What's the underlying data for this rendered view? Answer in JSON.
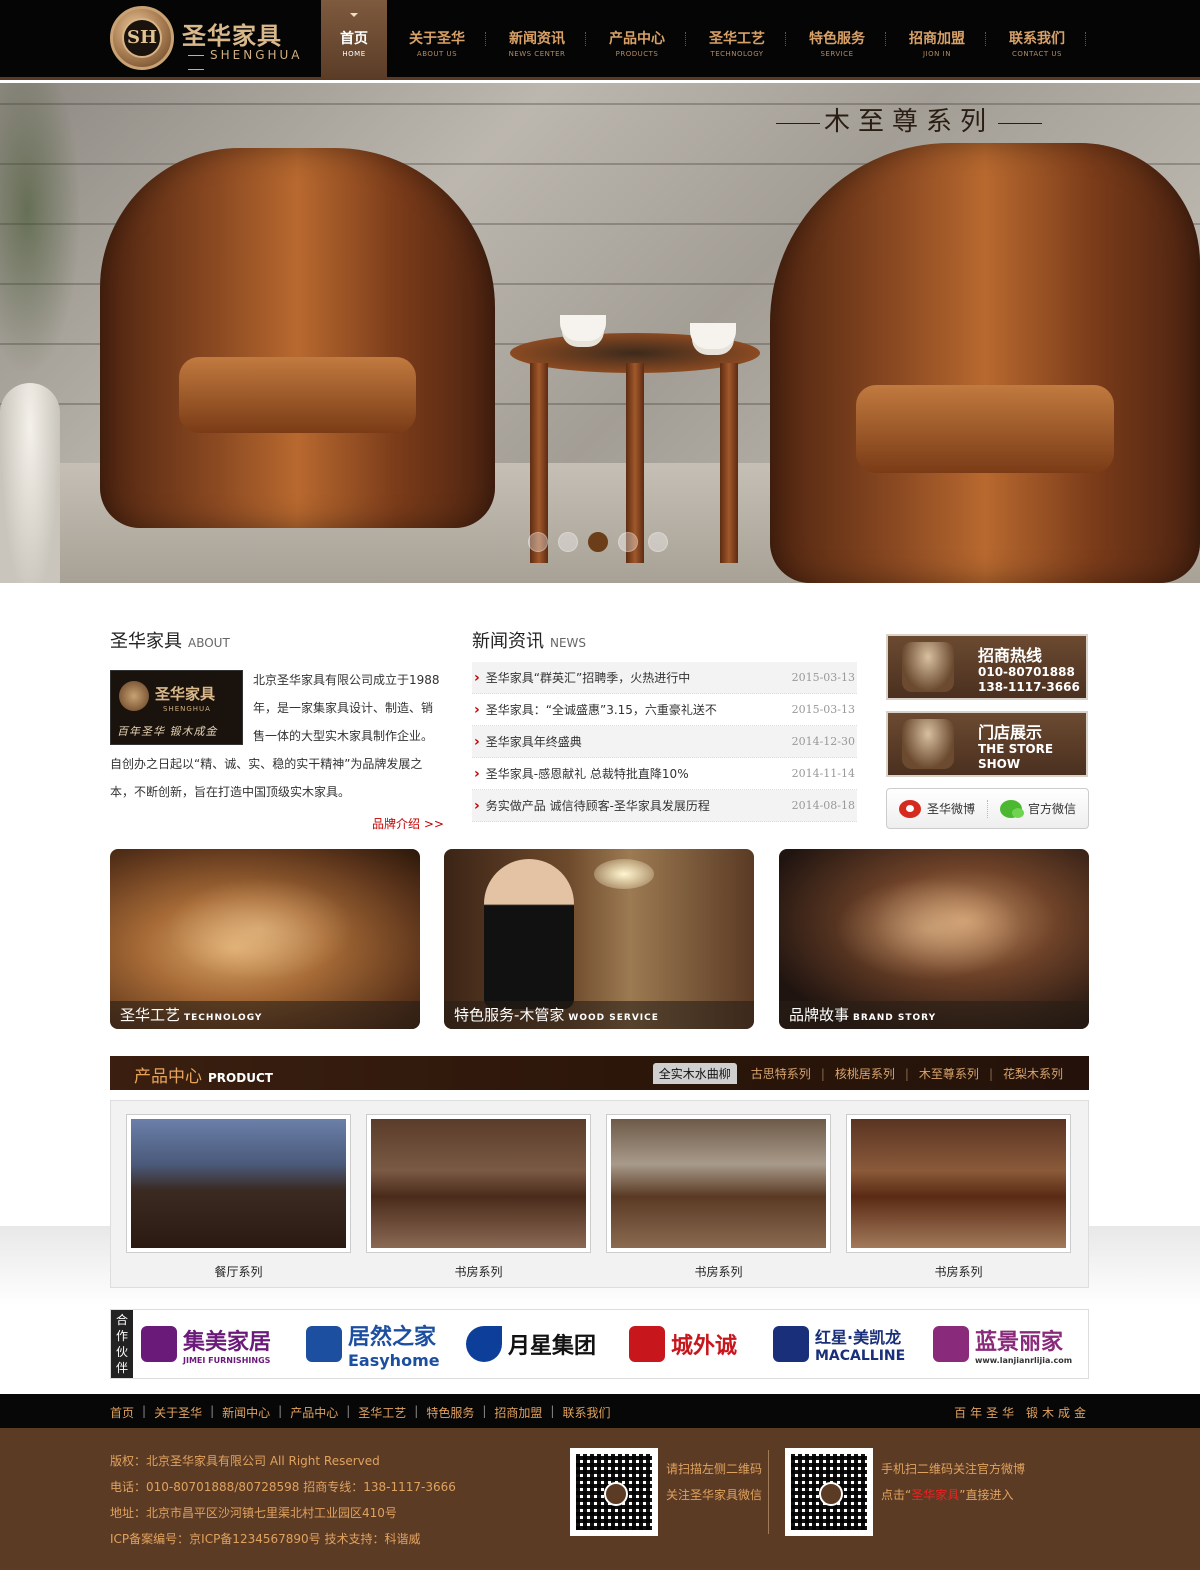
{
  "brand": {
    "cn": "圣华家具",
    "en": "SHENGHUA",
    "emblem": "SH"
  },
  "nav": [
    {
      "cn": "首页",
      "en": "HOME",
      "active": true
    },
    {
      "cn": "关于圣华",
      "en": "ABOUT US"
    },
    {
      "cn": "新闻资讯",
      "en": "NEWS CENTER"
    },
    {
      "cn": "产品中心",
      "en": "PRODUCTS"
    },
    {
      "cn": "圣华工艺",
      "en": "TECHNOLOGY"
    },
    {
      "cn": "特色服务",
      "en": "SERVICE"
    },
    {
      "cn": "招商加盟",
      "en": "JION IN"
    },
    {
      "cn": "联系我们",
      "en": "CONTACT US"
    }
  ],
  "banner": {
    "title": "木至尊系列",
    "slide_count": 5,
    "active_slide": 3
  },
  "about": {
    "title": "圣华家具",
    "title_en": "ABOUT",
    "img_cn": "圣华家具",
    "img_en": "SHENGHUA",
    "img_slogan": "百年圣华 锻木成金",
    "text": "北京圣华家具有限公司成立于1988年，是一家集家具设计、制造、销售一体的大型实木家具制作企业。自创办之日起以“精、诚、实、稳的实干精神”为品牌发展之本，不断创新，旨在打造中国顶级实木家具。",
    "more": "品牌介绍 >>"
  },
  "news": {
    "title": "新闻资讯",
    "title_en": "NEWS",
    "items": [
      {
        "title": "圣华家具“群英汇”招聘季，火热进行中",
        "date": "2015-03-13"
      },
      {
        "title": "圣华家具：“全诚盛惠”3.15，六重豪礼送不",
        "date": "2015-03-13"
      },
      {
        "title": "圣华家具年终盛典",
        "date": "2014-12-30"
      },
      {
        "title": "圣华家具-感恩献礼 总裁特批直降10%",
        "date": "2014-11-14"
      },
      {
        "title": "务实做产品 诚信待顾客-圣华家具发展历程",
        "date": "2014-08-18"
      }
    ]
  },
  "promos": [
    {
      "l1": "招商热线",
      "l2": "010-80701888",
      "l3": "138-1117-3666",
      "icon": "handshake-icon"
    },
    {
      "l1": "门店展示",
      "l2": "THE STORE",
      "l3": "SHOW",
      "icon": "butler-icon"
    }
  ],
  "social": {
    "weibo": "圣华微博",
    "wechat": "官方微信"
  },
  "tiles": [
    {
      "cn": "圣华工艺",
      "en": "TECHNOLOGY"
    },
    {
      "cn": "特色服务-木管家",
      "en": "WOOD SERVICE"
    },
    {
      "cn": "品牌故事",
      "en": "BRAND STORY"
    }
  ],
  "products": {
    "title": "产品中心",
    "title_en": "PRODUCT",
    "tabs": [
      "全实木水曲柳",
      "古思特系列",
      "核桃居系列",
      "木至尊系列",
      "花梨木系列"
    ],
    "active_tab": 0,
    "items": [
      {
        "name": "餐厅系列"
      },
      {
        "name": "书房系列"
      },
      {
        "name": "书房系列"
      },
      {
        "name": "书房系列"
      }
    ]
  },
  "partners": {
    "label": "合作伙伴",
    "items": [
      {
        "cn": "集美家居",
        "en": "JIMEI FURNISHINGS",
        "color": "#6a1b7a"
      },
      {
        "cn": "居然之家",
        "en": "Easyhome",
        "color": "#1d4fa0"
      },
      {
        "cn": "月星集团",
        "en": "",
        "color": "#0d3f9a"
      },
      {
        "cn": "城外诚",
        "en": "",
        "color": "#c8161d"
      },
      {
        "cn": "红星·美凯龙",
        "en": "MACALLINE",
        "color": "#1a2f7a"
      },
      {
        "cn": "蓝景丽家",
        "en": "www.lanjianrlijia.com",
        "color": "#8a2a7a"
      }
    ]
  },
  "footer": {
    "links": [
      "首页",
      "关于圣华",
      "新闻中心",
      "产品中心",
      "圣华工艺",
      "特色服务",
      "招商加盟",
      "联系我们"
    ],
    "slogan": "百年圣华 锻木成金",
    "info": [
      "版权：北京圣华家具有限公司 All Right Reserved",
      "电话：010-80701888/80728598   招商专线：138-1117-3666",
      "地址：北京市昌平区沙河镇七里渠北村工业园区410号",
      "ICP备案编号：京ICP备1234567890号   技术支持：科谐威"
    ],
    "qr1_line1": "请扫描左侧二维码",
    "qr1_line2": "关注圣华家具微信",
    "qr2_line1": "手机扫二维码关注官方微博",
    "qr2_line2_a": "点击“",
    "qr2_line2_hl": "圣华家具",
    "qr2_line2_b": "”直接进入"
  },
  "colors": {
    "accent": "#e0a25f",
    "dark": "#050505",
    "footer_bg": "#5b3b24",
    "news_arrow": "#c40000"
  }
}
